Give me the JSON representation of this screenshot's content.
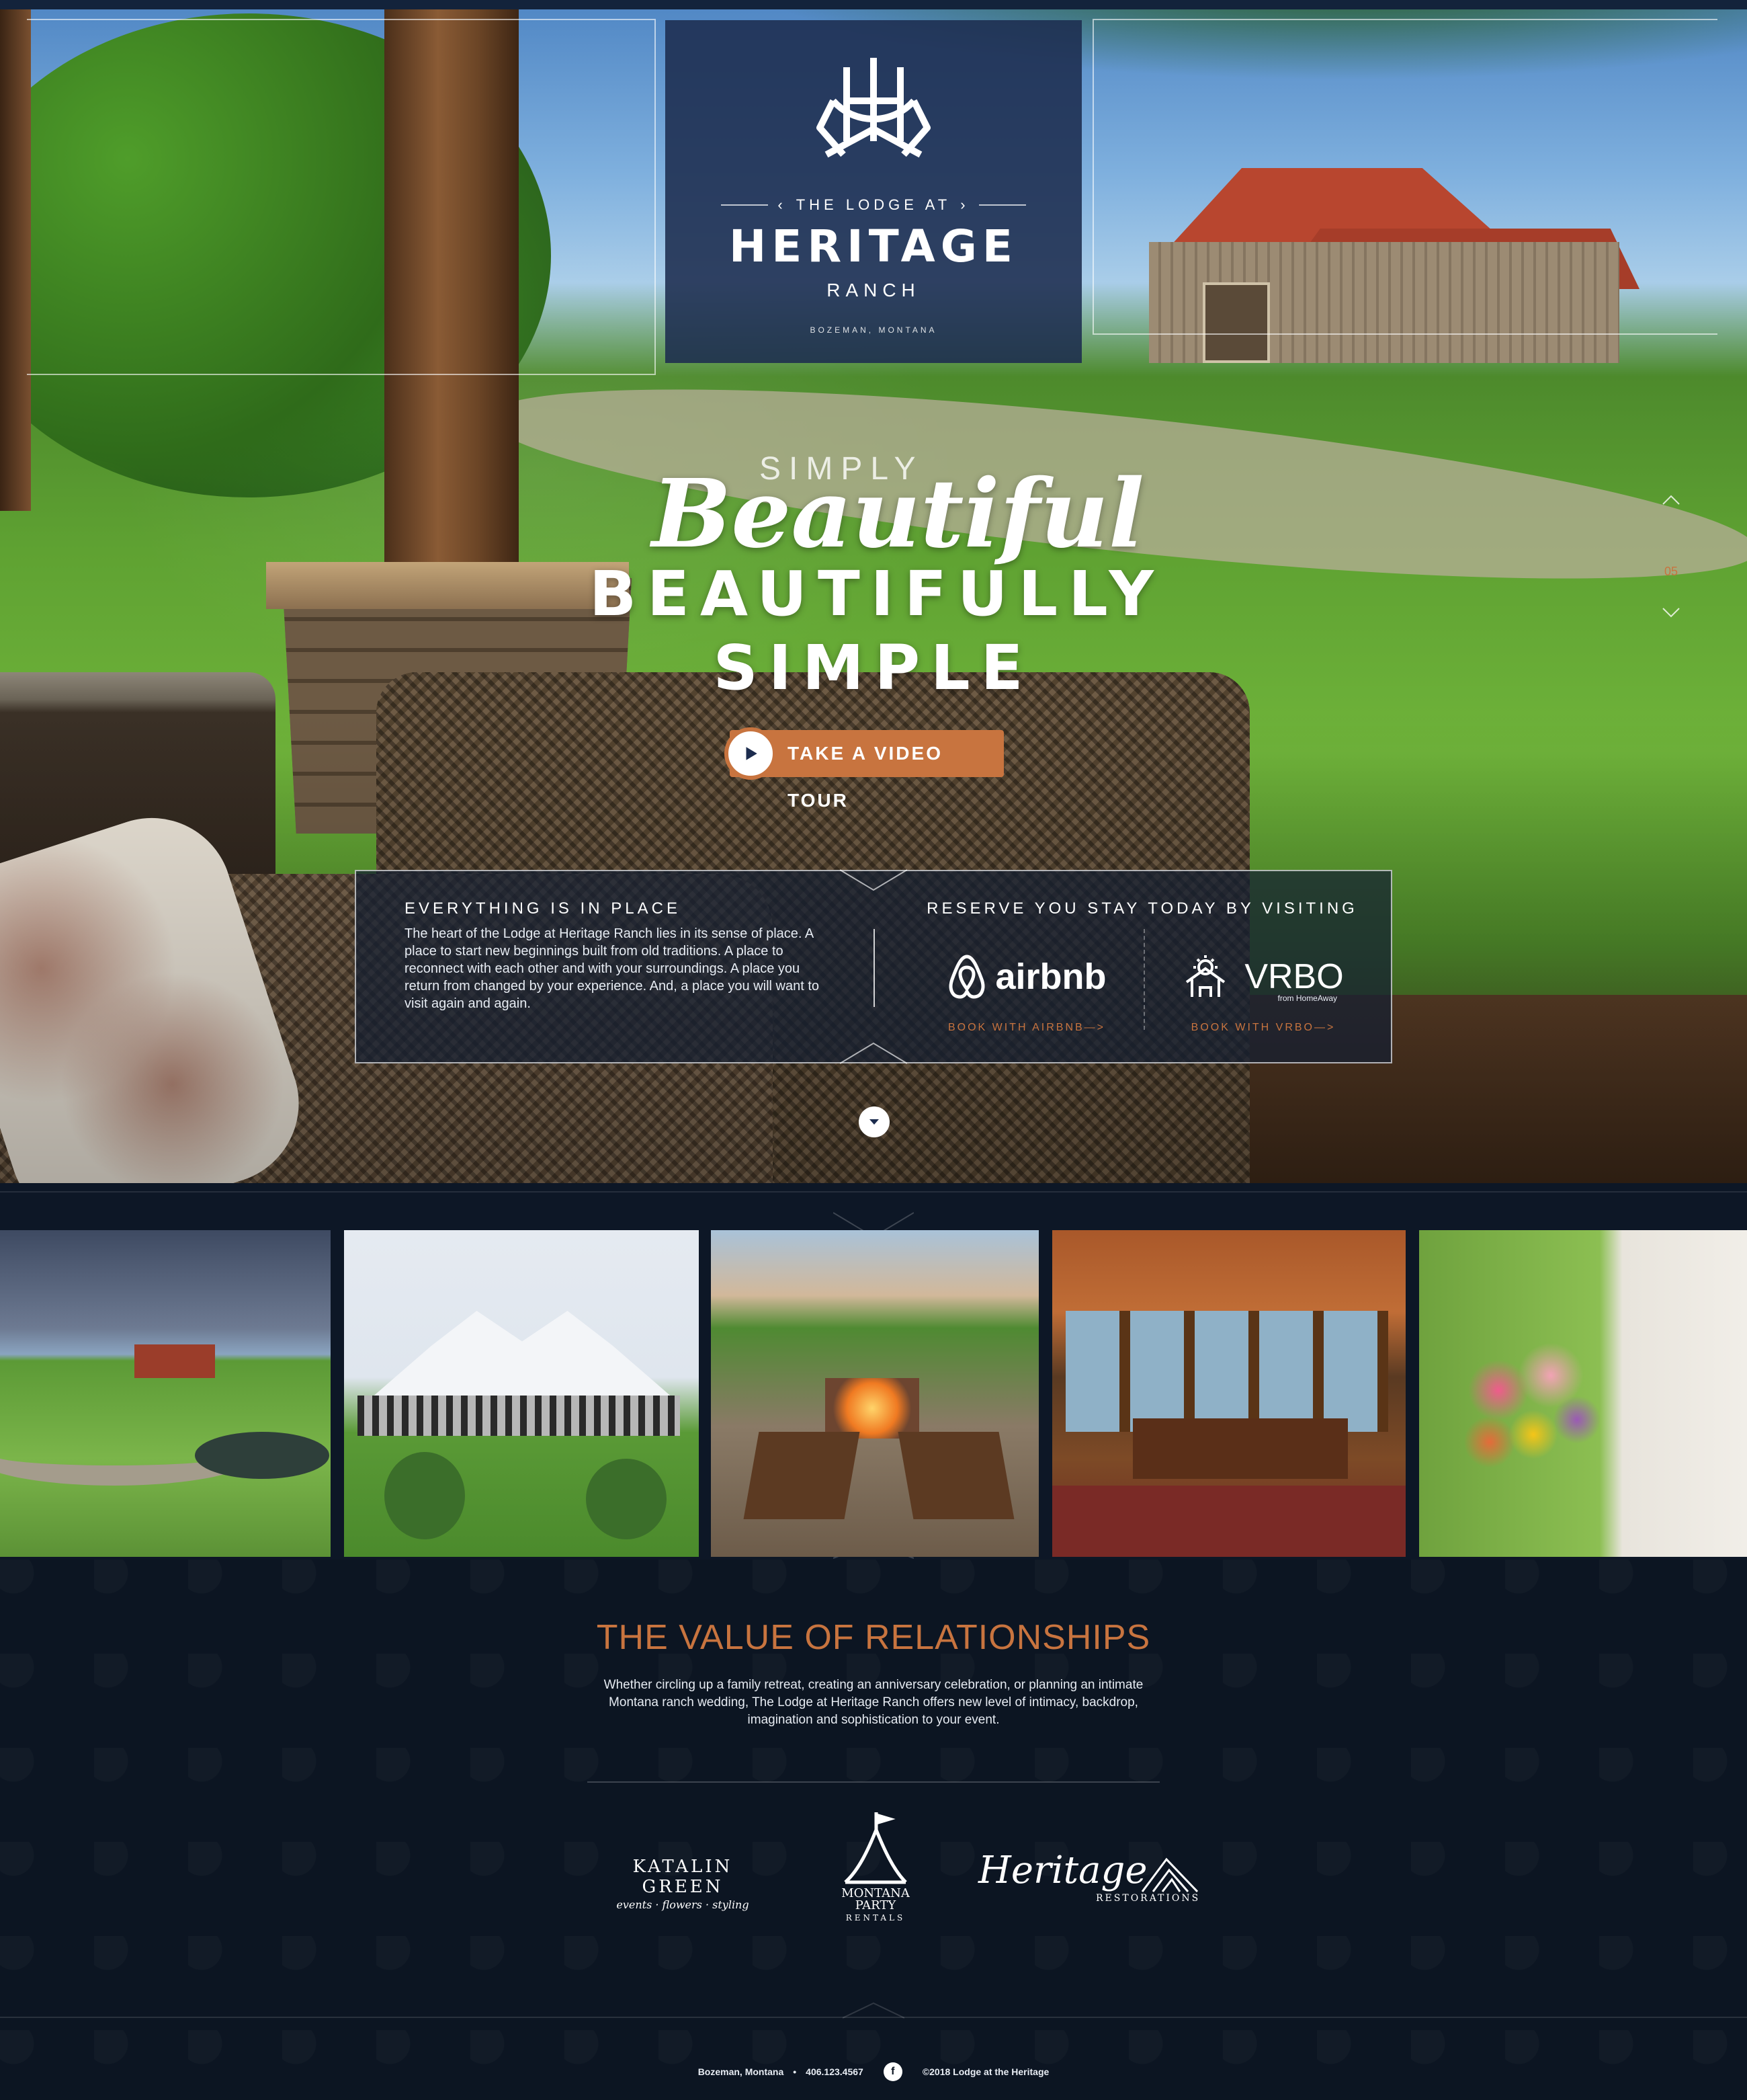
{
  "brand": {
    "top_line": "THE LODGE AT",
    "name": "HERITAGE",
    "sub": "RANCH",
    "location": "BOZEMAN, MONTANA"
  },
  "hero": {
    "simply": "SIMPLY",
    "beautiful": "Beautiful",
    "line1": "BEAUTIFULLY",
    "line2": "SIMPLE",
    "video_button": "TAKE A VIDEO TOUR",
    "slide_number": "05"
  },
  "info": {
    "heading": "EVERYTHING IS IN PLACE",
    "body": "The heart of the Lodge at Heritage Ranch lies in its sense of place. A place to start new beginnings built from old traditions. A place to reconnect with each other and with your surroundings. A place you return from changed by your experience. And, a place you will want to visit again and again.",
    "reserve_title": "RESERVE YOU STAY TODAY BY VISITING",
    "airbnb": {
      "brand": "airbnb",
      "link": "BOOK WITH AIRBNB—>"
    },
    "vrbo": {
      "brand": "VRBO",
      "sub": "from HomeAway",
      "link": "BOOK WITH VRBO—>"
    }
  },
  "value": {
    "title": "THE VALUE OF RELATIONSHIPS",
    "text": "Whether circling up a family retreat, creating an anniversary celebration, or planning an intimate Montana ranch wedding, The Lodge at Heritage Ranch offers new level of intimacy, backdrop, imagination and sophistication to your event."
  },
  "sponsors": {
    "katalin": {
      "name": "KATALIN GREEN",
      "tag": "events · flowers · styling"
    },
    "montana": {
      "line1": "MONTANA",
      "line2": "PARTY",
      "line3": "RENTALS"
    },
    "heritage": {
      "name": "Heritage",
      "tag": "RESTORATIONS"
    }
  },
  "footer": {
    "location": "Bozeman, Montana",
    "phone": "406.123.4567",
    "copyright": "©2018 Lodge at the Heritage"
  },
  "colors": {
    "accent": "#c8743f",
    "navy": "#0c1522",
    "panel": "#1c2c4e"
  }
}
